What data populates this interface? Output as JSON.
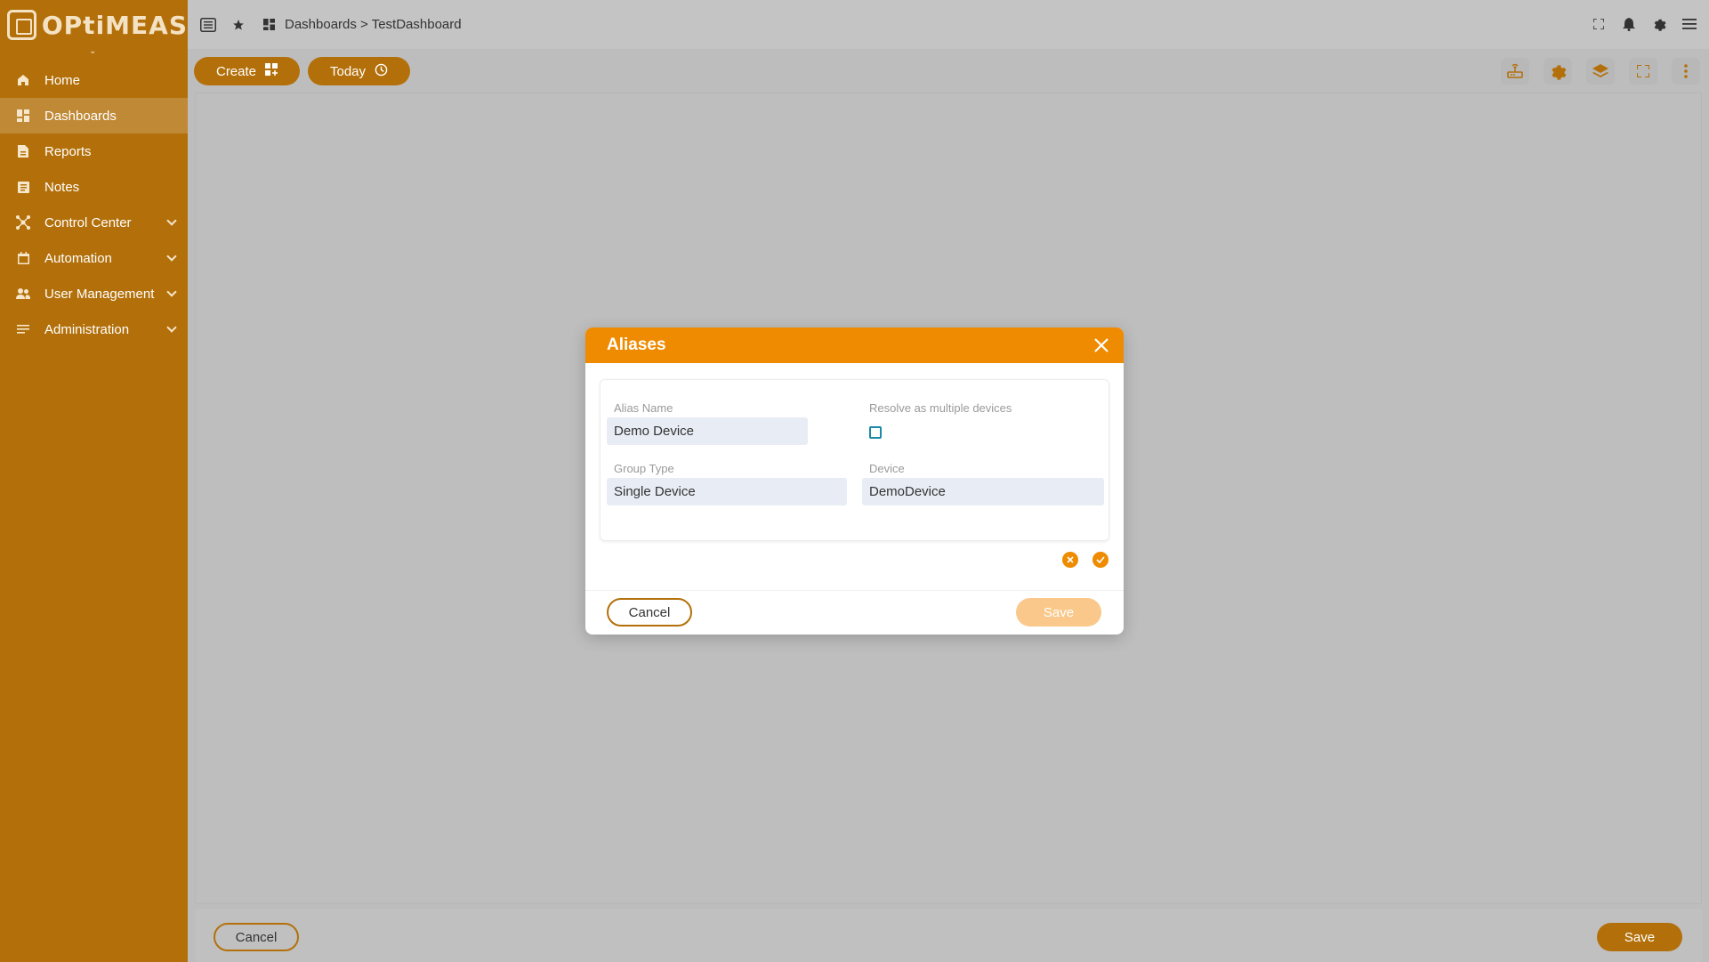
{
  "sidebar": {
    "logo_text": "OPtiMEAS",
    "items": [
      {
        "label": "Home",
        "icon": "home-icon"
      },
      {
        "label": "Dashboards",
        "icon": "dashboard-icon",
        "active": true
      },
      {
        "label": "Reports",
        "icon": "document-icon"
      },
      {
        "label": "Notes",
        "icon": "notes-icon"
      },
      {
        "label": "Control Center",
        "icon": "hub-icon",
        "expandable": true
      },
      {
        "label": "Automation",
        "icon": "calendar-icon",
        "expandable": true
      },
      {
        "label": "User Management",
        "icon": "users-icon",
        "expandable": true
      },
      {
        "label": "Administration",
        "icon": "list-icon",
        "expandable": true
      }
    ]
  },
  "topbar": {
    "breadcrumb": "Dashboards > TestDashboard"
  },
  "toolbar": {
    "create_label": "Create",
    "today_label": "Today"
  },
  "dialog": {
    "title": "Aliases",
    "alias_name_label": "Alias Name",
    "alias_name_value": "Demo Device",
    "resolve_label": "Resolve as multiple devices",
    "resolve_checked": false,
    "group_type_label": "Group Type",
    "group_type_value": "Single Device",
    "device_label": "Device",
    "device_value": "DemoDevice",
    "cancel_label": "Cancel",
    "save_label": "Save"
  },
  "bottom": {
    "cancel_label": "Cancel",
    "save_label": "Save"
  },
  "colors": {
    "sidebar": "#b3700a",
    "accent": "#ef8b00",
    "overlay_bg": "#bdbdbd",
    "save_disabled": "#f9c88a"
  }
}
